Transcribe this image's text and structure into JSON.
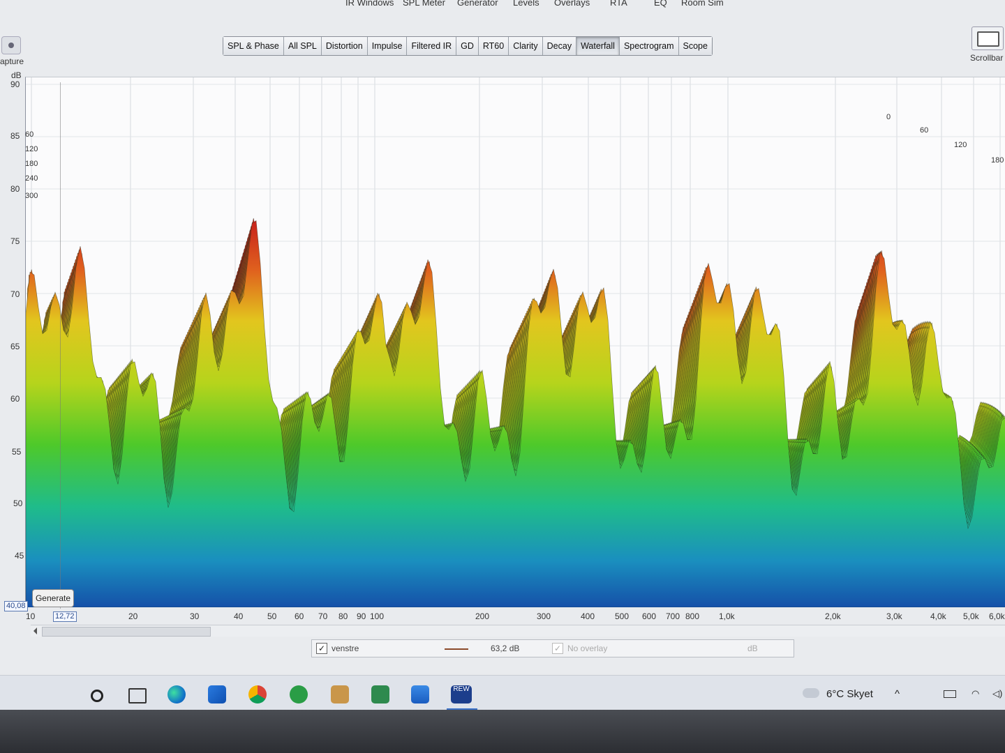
{
  "menu": [
    "IR Windows",
    "SPL Meter",
    "Generator",
    "Levels",
    "Overlays",
    "RTA",
    "EQ",
    "Room Sim"
  ],
  "left_toolbar": {
    "capture_label": "apture"
  },
  "right_toolbar": {
    "scrollbar_label": "Scrollbar"
  },
  "tabs": [
    {
      "label": "SPL & Phase",
      "active": false
    },
    {
      "label": "All SPL",
      "active": false
    },
    {
      "label": "Distortion",
      "active": false
    },
    {
      "label": "Impulse",
      "active": false
    },
    {
      "label": "Filtered IR",
      "active": false
    },
    {
      "label": "GD",
      "active": false
    },
    {
      "label": "RT60",
      "active": false
    },
    {
      "label": "Clarity",
      "active": false
    },
    {
      "label": "Decay",
      "active": false
    },
    {
      "label": "Waterfall",
      "active": true
    },
    {
      "label": "Spectrogram",
      "active": false
    },
    {
      "label": "Scope",
      "active": false
    }
  ],
  "graph": {
    "y_unit": "dB",
    "y_ticks": [
      "90",
      "85",
      "80",
      "75",
      "70",
      "65",
      "60",
      "55",
      "50",
      "45"
    ],
    "x_ticks": [
      "10",
      "20",
      "30",
      "40",
      "50",
      "60",
      "70",
      "80",
      "90",
      "100",
      "200",
      "300",
      "400",
      "500",
      "600",
      "700",
      "800",
      "1,0k",
      "2,0k",
      "3,0k",
      "4,0k",
      "5,0k",
      "6,0k"
    ],
    "z_ticks_left": [
      "60",
      "120",
      "180",
      "240",
      "300"
    ],
    "z_ticks_right": [
      "0",
      "60",
      "120",
      "180"
    ],
    "y_readout": "40,08",
    "x_readout": "12,72",
    "generate_label": "Generate"
  },
  "legend": {
    "measurement_name": "venstre",
    "measurement_value": "63,2 dB",
    "overlay_label": "No overlay",
    "overlay_unit": "dB",
    "line_color": "#8b4a2a"
  },
  "taskbar": {
    "weather": "6°C  Skyet",
    "pinned": [
      "search-icon",
      "task-view-icon",
      "edge-icon",
      "store-icon",
      "chrome-icon",
      "spotify-icon",
      "notes-icon",
      "editor-icon",
      "mail-icon",
      "rew-icon"
    ],
    "rew_label": "REW"
  }
}
